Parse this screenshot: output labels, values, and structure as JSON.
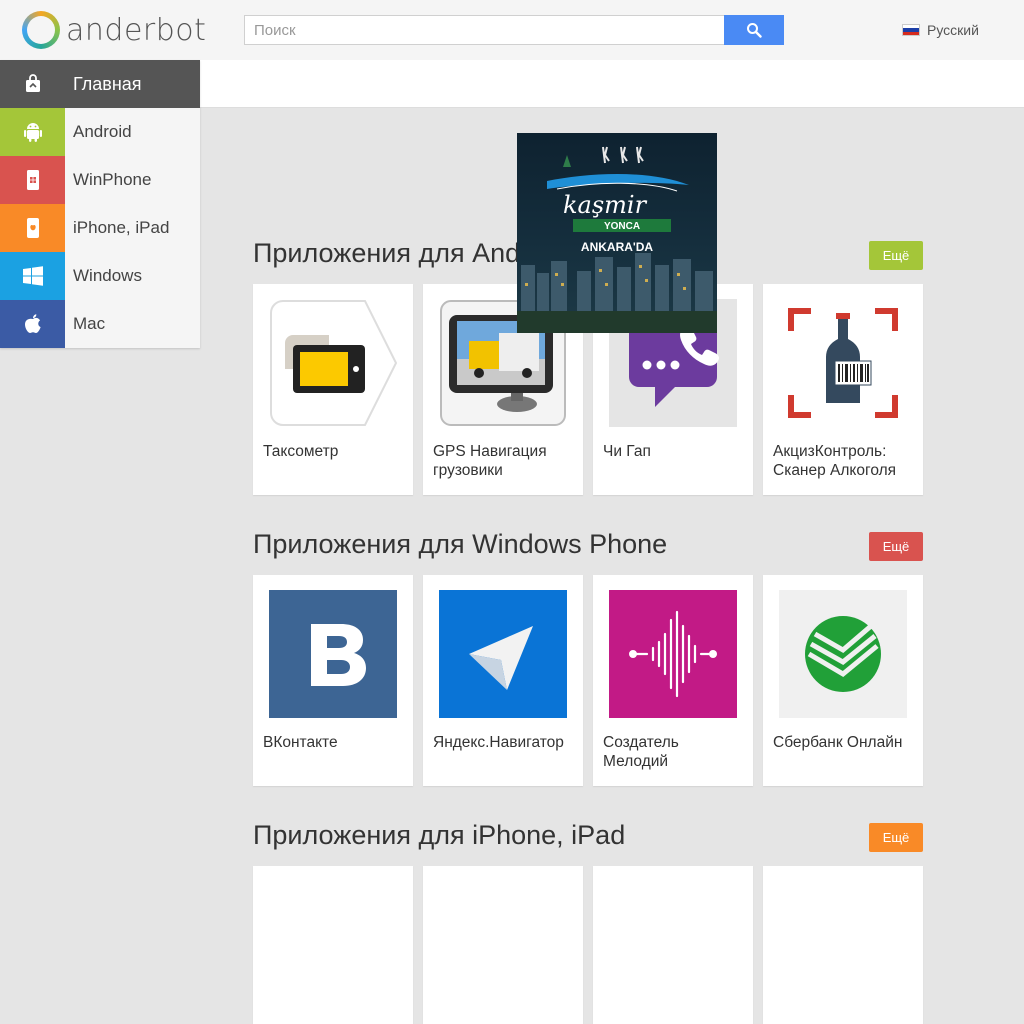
{
  "header": {
    "logo_text": "anderbot",
    "search_placeholder": "Поиск",
    "language": "Русский"
  },
  "sidebar": {
    "items": [
      {
        "label": "Главная",
        "icon": "shopping-bag-icon",
        "color": "#555555"
      },
      {
        "label": "Android",
        "icon": "android-icon",
        "color": "#a4c639"
      },
      {
        "label": "WinPhone",
        "icon": "winphone-icon",
        "color": "#d9534f"
      },
      {
        "label": "iPhone, iPad",
        "icon": "iphone-icon",
        "color": "#f98a27"
      },
      {
        "label": "Windows",
        "icon": "windows-icon",
        "color": "#1ba1e2"
      },
      {
        "label": "Mac",
        "icon": "apple-icon",
        "color": "#3b5ba5"
      }
    ]
  },
  "ad": {
    "brand": "kaşmir",
    "sub": "YONCA",
    "city": "ANKARA'DA"
  },
  "sections": [
    {
      "title": "Приложения для Android",
      "more": "Ещё",
      "color": "#a4c639",
      "apps": [
        {
          "name": "Таксометр",
          "icon": "taximeter-icon"
        },
        {
          "name": "GPS Навигация грузовики",
          "icon": "gps-truck-icon"
        },
        {
          "name": "Чи Гап",
          "icon": "chat-phone-icon"
        },
        {
          "name": "АкцизКонтроль: Сканер Алкоголя",
          "icon": "bottle-scanner-icon"
        }
      ]
    },
    {
      "title": "Приложения для Windows Phone",
      "more": "Ещё",
      "color": "#d9534f",
      "apps": [
        {
          "name": "ВКонтакте",
          "icon": "vk-icon"
        },
        {
          "name": "Яндекс.Навигатор",
          "icon": "navigator-arrow-icon"
        },
        {
          "name": "Создатель Мелодий",
          "icon": "melody-wave-icon"
        },
        {
          "name": "Сбербанк Онлайн",
          "icon": "sberbank-icon"
        }
      ]
    },
    {
      "title": "Приложения для iPhone, iPad",
      "more": "Ещё",
      "color": "#f98a27",
      "apps": []
    }
  ]
}
